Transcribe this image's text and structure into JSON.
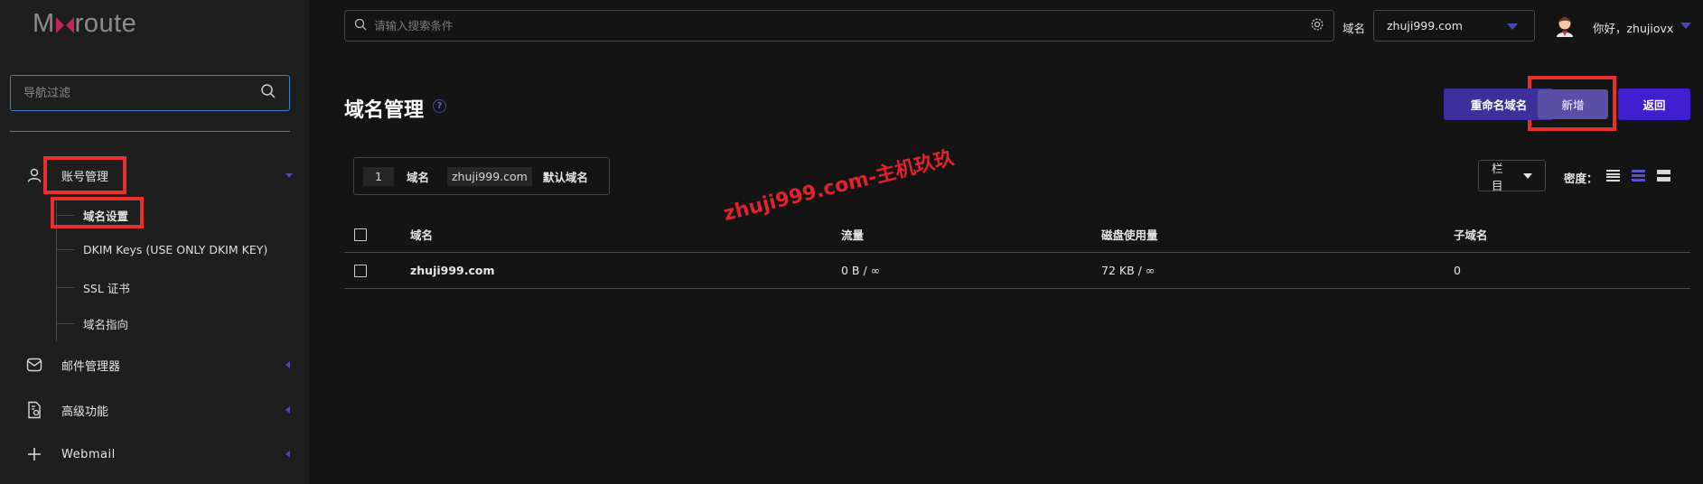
{
  "logo": {
    "text_before": "M",
    "text_after": "route"
  },
  "sidebar": {
    "filter_placeholder": "导航过滤",
    "items": [
      {
        "label": "账号管理",
        "icon": "user-icon",
        "expanded": true
      },
      {
        "label": "邮件管理器",
        "icon": "mail-icon",
        "expanded": false
      },
      {
        "label": "高级功能",
        "icon": "document-settings-icon",
        "expanded": false
      },
      {
        "label": "Webmail",
        "icon": "plus-icon",
        "expanded": false
      }
    ],
    "sub_items": [
      {
        "label": "域名设置",
        "active": true
      },
      {
        "label": "DKIM Keys (USE ONLY DKIM KEY)",
        "active": false
      },
      {
        "label": "SSL 证书",
        "active": false
      },
      {
        "label": "域名指向",
        "active": false
      }
    ]
  },
  "topbar": {
    "search_placeholder": "请输入搜索条件",
    "domain_label": "域名",
    "domain_value": "zhuji999.com",
    "greeting": "你好，zhujiovx"
  },
  "page": {
    "title": "域名管理",
    "buttons": {
      "rename": "重命名域名",
      "add": "新增",
      "back": "返回"
    }
  },
  "filter_chip": {
    "count": "1",
    "label": "域名",
    "value": "zhuji999.com",
    "tag": "默认域名"
  },
  "toolbar": {
    "columns_label": "栏目",
    "density_label": "密度："
  },
  "table": {
    "headers": [
      "域名",
      "流量",
      "磁盘使用量",
      "子域名"
    ],
    "rows": [
      [
        "zhuji999.com",
        "0 B / ∞",
        "72 KB / ∞",
        "0"
      ]
    ]
  },
  "watermark": "zhuji999.com-主机玖玖",
  "colors": {
    "accent": "#4b46b8",
    "highlight": "#e8302e",
    "primary_button": "#3f1fd0",
    "sidebar_bg": "#1e1e1e",
    "page_bg": "#141414"
  }
}
